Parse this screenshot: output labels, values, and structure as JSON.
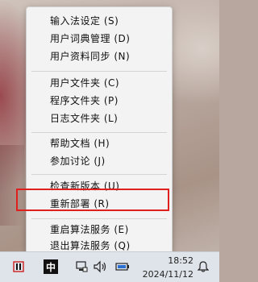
{
  "menu": {
    "items": [
      {
        "label": "输入法设定 (S)"
      },
      {
        "label": "用户词典管理 (D)"
      },
      {
        "label": "用户资料同步 (N)"
      },
      {
        "label": "用户文件夹 (C)"
      },
      {
        "label": "程序文件夹 (P)"
      },
      {
        "label": "日志文件夹 (L)"
      },
      {
        "label": "帮助文档 (H)"
      },
      {
        "label": "参加讨论 (J)"
      },
      {
        "label": "检查新版本 (U)"
      },
      {
        "label": "重新部署 (R)"
      },
      {
        "label": "重启算法服务 (E)"
      },
      {
        "label": "退出算法服务 (Q)"
      }
    ],
    "highlighted_item": "重新部署 (R)",
    "highlight_color": "#e0201e"
  },
  "taskbar": {
    "time": "18:52",
    "date": "2024/11/12",
    "ime_indicator": "中",
    "icons": [
      "app-grid-icon",
      "ime-icon",
      "network-icon",
      "volume-icon",
      "battery-icon",
      "notification-bell-icon"
    ]
  }
}
